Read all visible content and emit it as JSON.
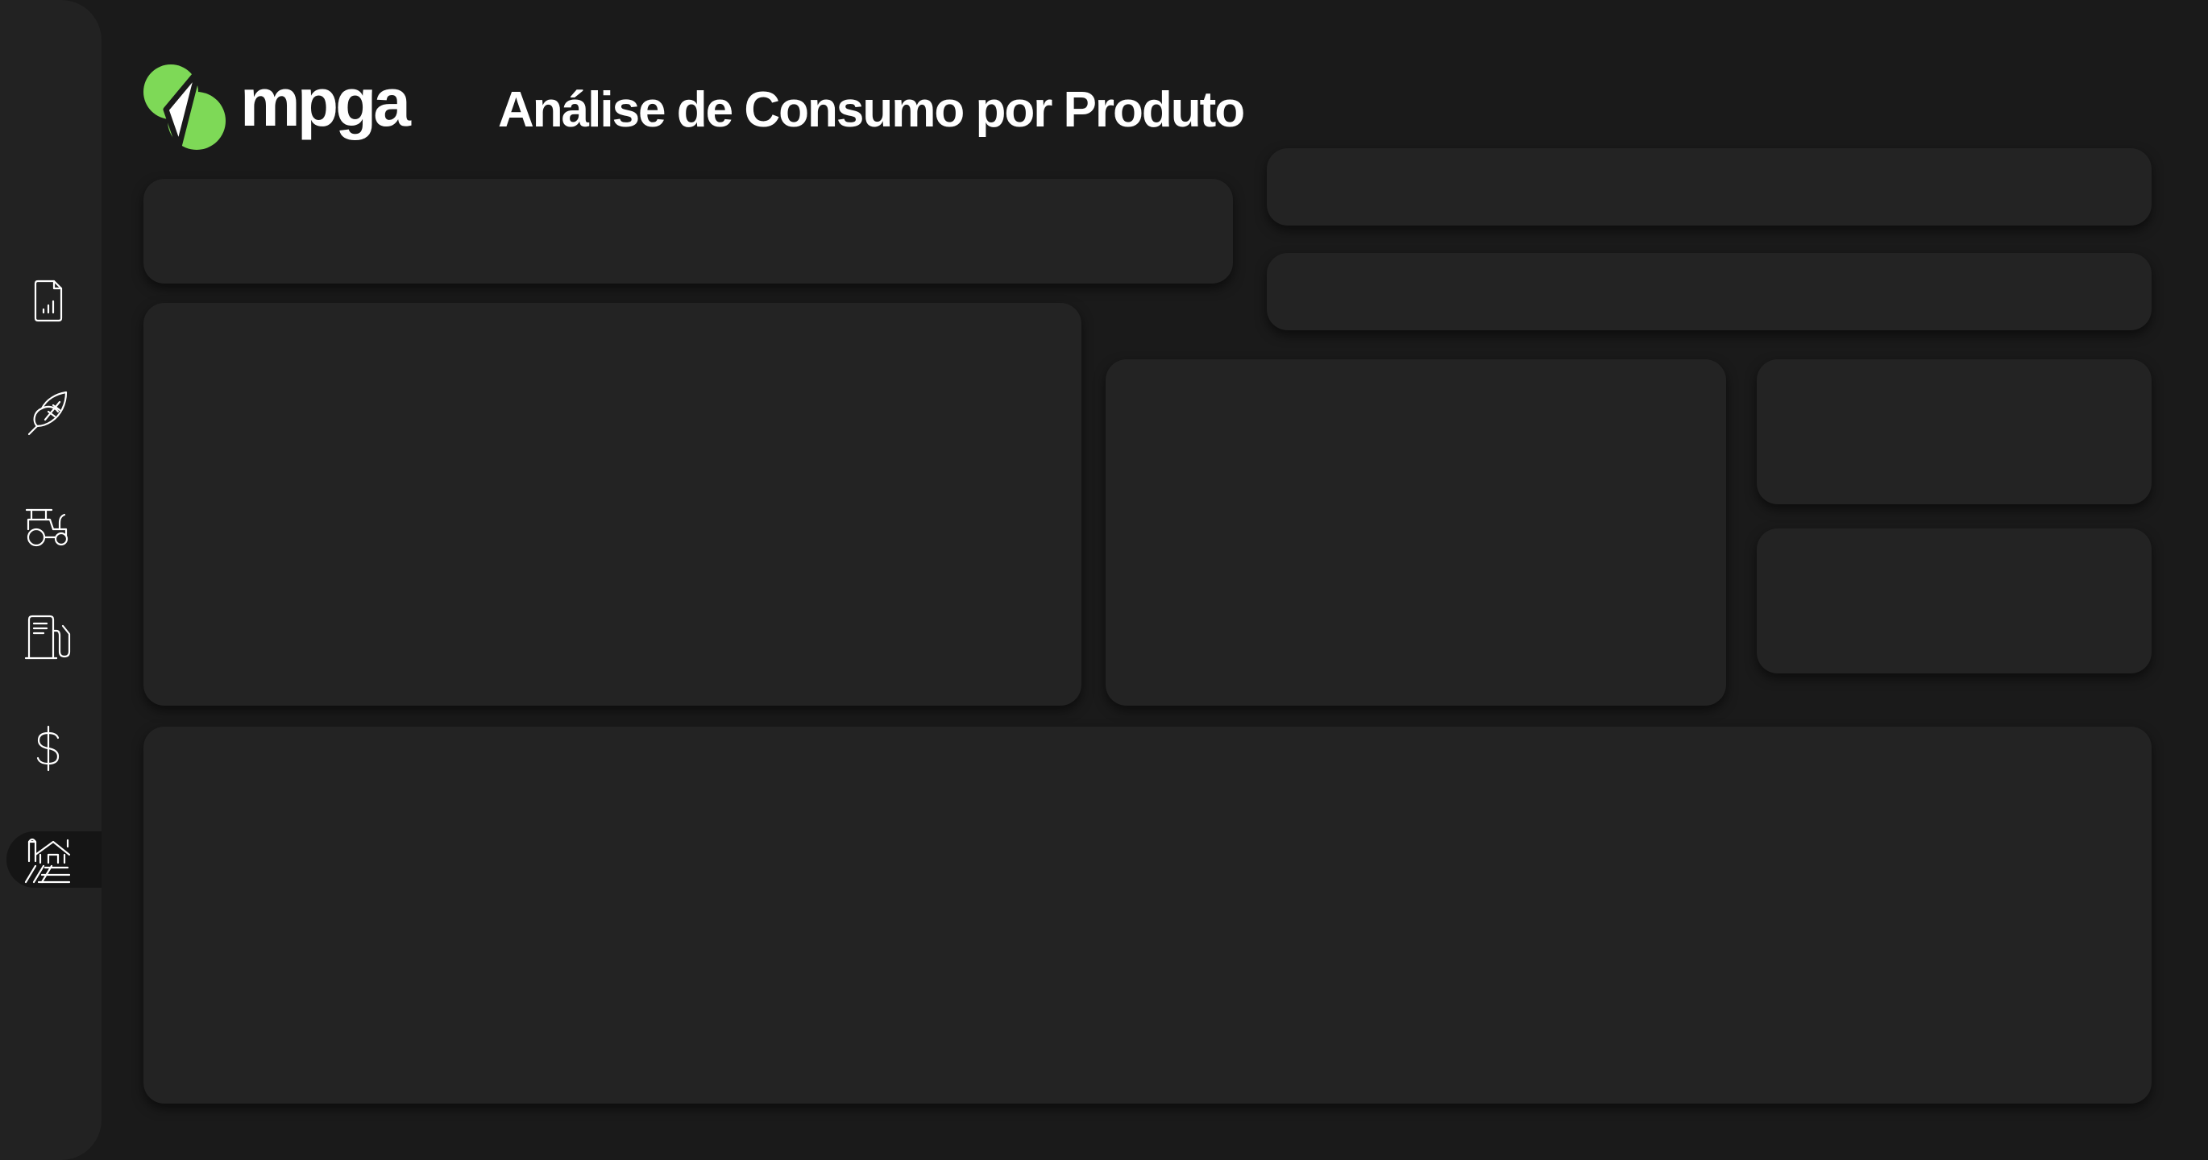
{
  "app": {
    "brand_name": "mpga",
    "page_title": "Análise de Consumo por Produto",
    "accent_color": "#7ed957",
    "background_color": "#1a1a1a",
    "panel_color": "#232323"
  },
  "sidebar": {
    "items": [
      {
        "icon": "report-chart-icon",
        "active": false
      },
      {
        "icon": "corn-icon",
        "active": false
      },
      {
        "icon": "tractor-icon",
        "active": false
      },
      {
        "icon": "fuel-pump-icon",
        "active": false
      },
      {
        "icon": "dollar-icon",
        "active": false
      },
      {
        "icon": "farm-icon",
        "active": true
      }
    ]
  }
}
